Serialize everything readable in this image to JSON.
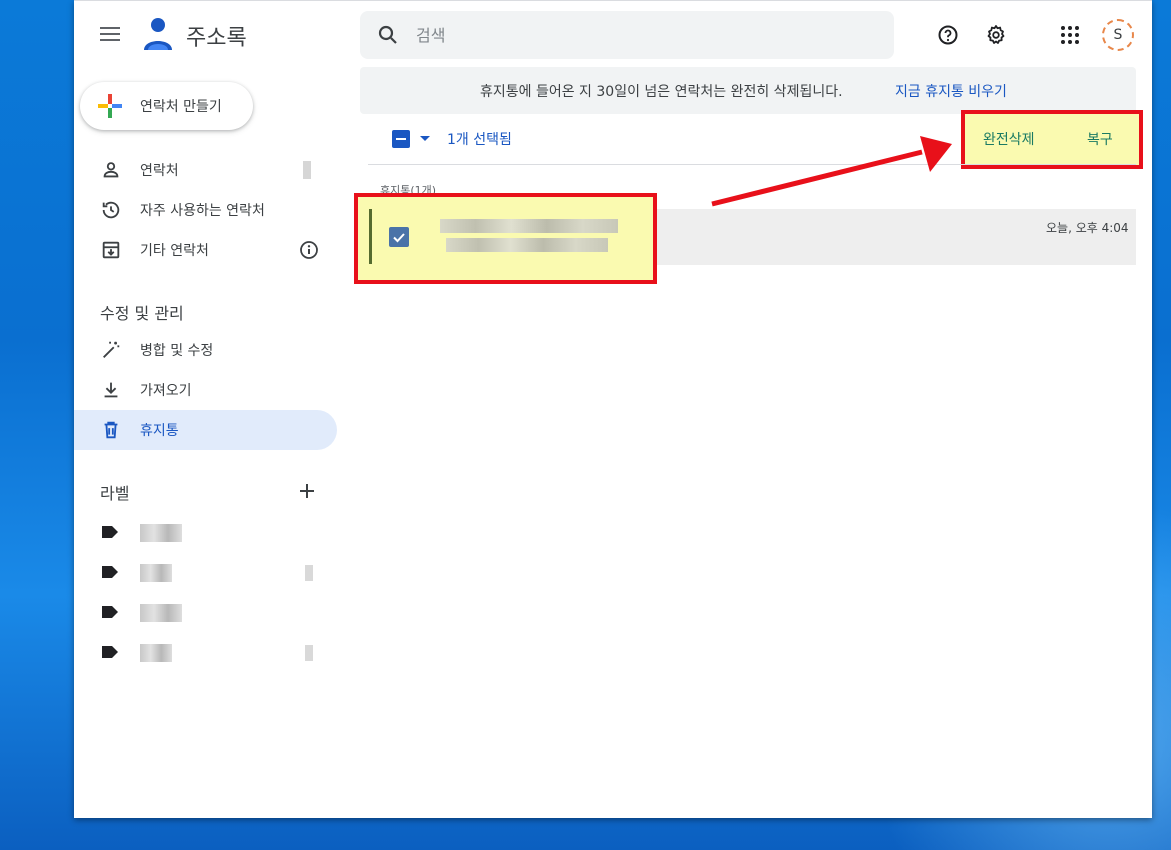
{
  "app": {
    "title": "주소록"
  },
  "header": {
    "search_placeholder": "검색",
    "avatar_initial": "S"
  },
  "sidebar": {
    "create_label": "연락처 만들기",
    "nav_items": [
      {
        "label": "연락처",
        "icon": "person-icon"
      },
      {
        "label": "자주 사용하는 연락처",
        "icon": "history-icon"
      },
      {
        "label": "기타 연락처",
        "icon": "archive-icon"
      }
    ],
    "manage_title": "수정 및 관리",
    "manage_items": [
      {
        "label": "병합 및 수정",
        "icon": "magic-wand-icon"
      },
      {
        "label": "가져오기",
        "icon": "download-icon"
      },
      {
        "label": "휴지통",
        "icon": "trash-icon",
        "active": true
      }
    ],
    "labels_title": "라벨"
  },
  "banner": {
    "text": "휴지통에 들어온 지 30일이 넘은 연락처는 완전히 삭제됩니다.",
    "link": "지금 휴지통 비우기"
  },
  "toolbar": {
    "selected_count": "1개 선택됨",
    "delete_forever": "완전삭제",
    "restore": "복구"
  },
  "list": {
    "section_header": "휴지통(1개)",
    "rows": [
      {
        "time": "오늘, 오후 4:04",
        "checked": true
      }
    ]
  },
  "colors": {
    "accent": "#1a57c2",
    "highlight_border": "#e8101a",
    "highlight_fill": "#fafab0"
  }
}
